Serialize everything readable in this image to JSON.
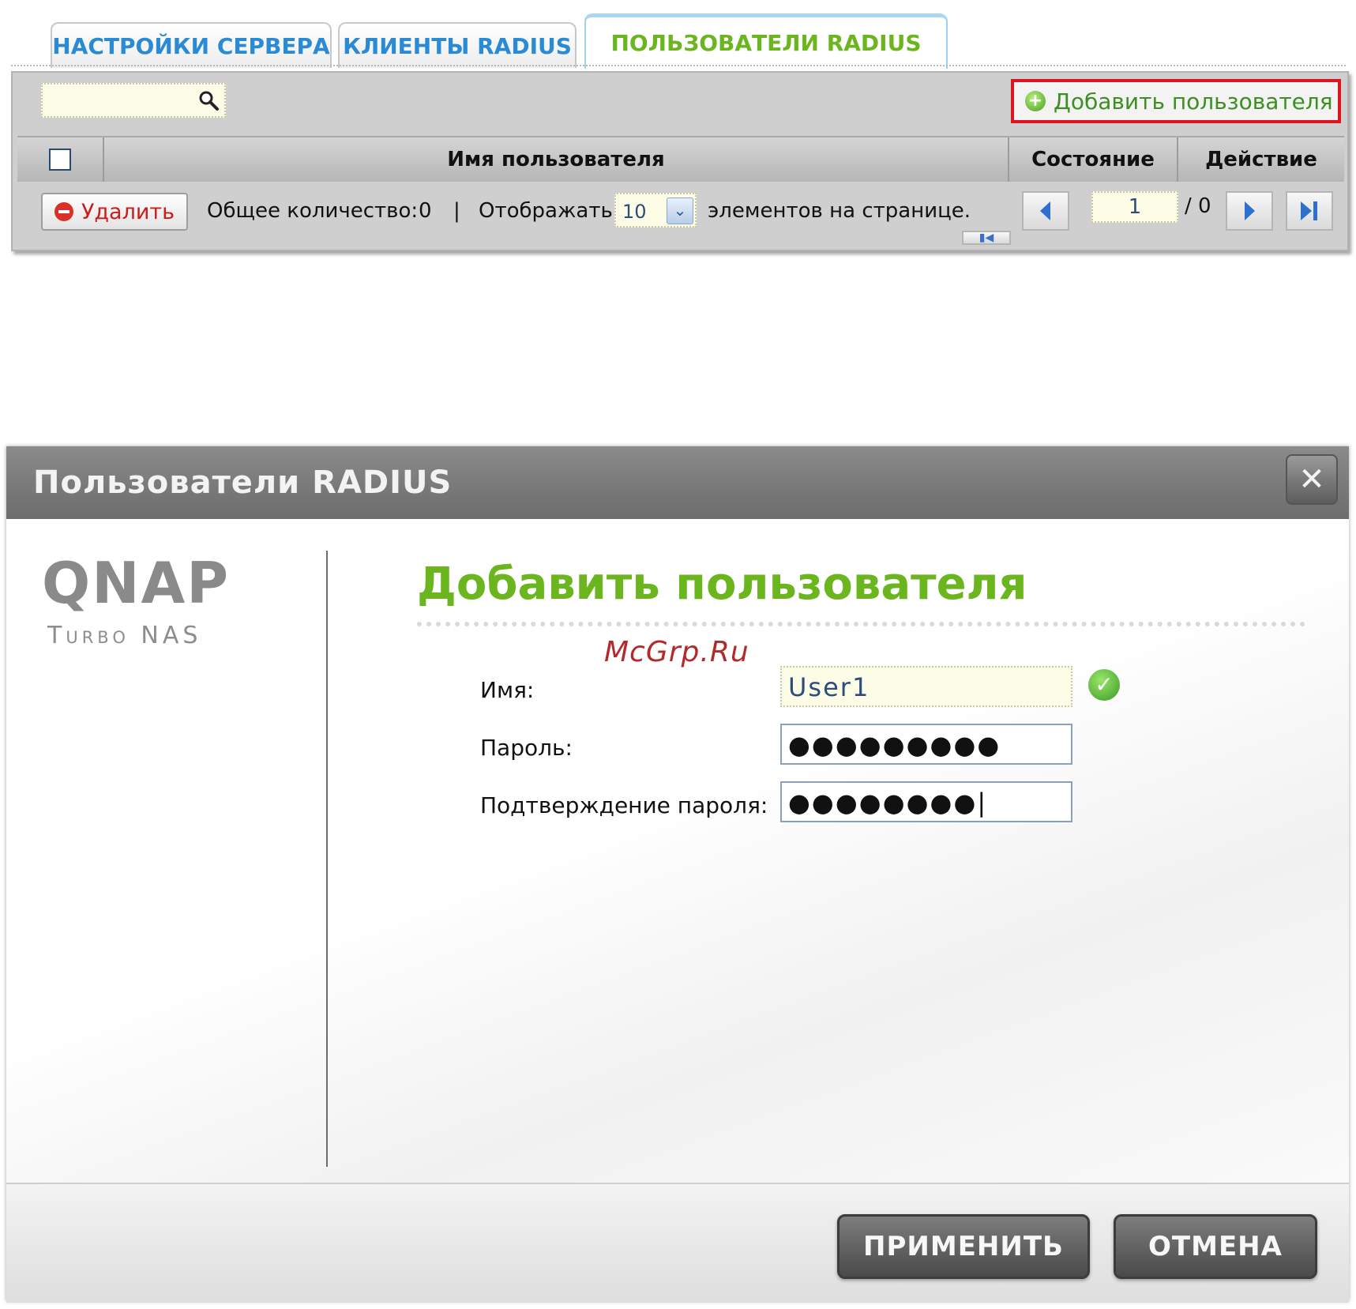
{
  "top_panel": {
    "tabs": [
      {
        "label": "НАСТРОЙКИ СЕРВЕРА"
      },
      {
        "label": "КЛИЕНТЫ RADIUS"
      },
      {
        "label": "ПОЛЬЗОВАТЕЛИ RADIUS"
      }
    ],
    "active_tab_index": 2,
    "search": {
      "value": "",
      "placeholder": ""
    },
    "add_user_label": "Добавить пользователя",
    "columns": [
      "Имя пользователя",
      "Состояние",
      "Действие"
    ],
    "delete_label": "Удалить",
    "total_label": "Общее количество:",
    "total_value": "0",
    "separator": "|",
    "display_label": "Отображать",
    "per_page_value": "10",
    "per_page_suffix": "элементов на странице.",
    "page_current": "1",
    "page_total": "/ 0"
  },
  "dialog": {
    "title": "Пользователи RADIUS",
    "logo": {
      "brand": "QNAP",
      "product": "Turbo NAS"
    },
    "heading": "Добавить пользователя",
    "watermark": "McGrp.Ru",
    "fields": {
      "name_label": "Имя:",
      "name_value": "User1",
      "password_label": "Пароль:",
      "password_value": "●●●●●●●●●",
      "confirm_label": "Подтверждение пароля:",
      "confirm_value": "●●●●●●●●|"
    },
    "apply_label": "ПРИМЕНИТЬ",
    "cancel_label": "ОТМЕНА"
  },
  "colors": {
    "tab_text": "#2a8ad4",
    "active_tab_text": "#6bb51e",
    "heading_green": "#6bb51e",
    "highlight_red": "#e0141e",
    "titlebar_gray": "#7a7a7a"
  },
  "icons": [
    "search-icon",
    "plus-circle-icon",
    "minus-circle-icon",
    "chevron-down-icon",
    "prev-page-icon",
    "next-page-icon",
    "last-page-icon",
    "first-page-icon",
    "close-icon",
    "check-circle-icon"
  ]
}
